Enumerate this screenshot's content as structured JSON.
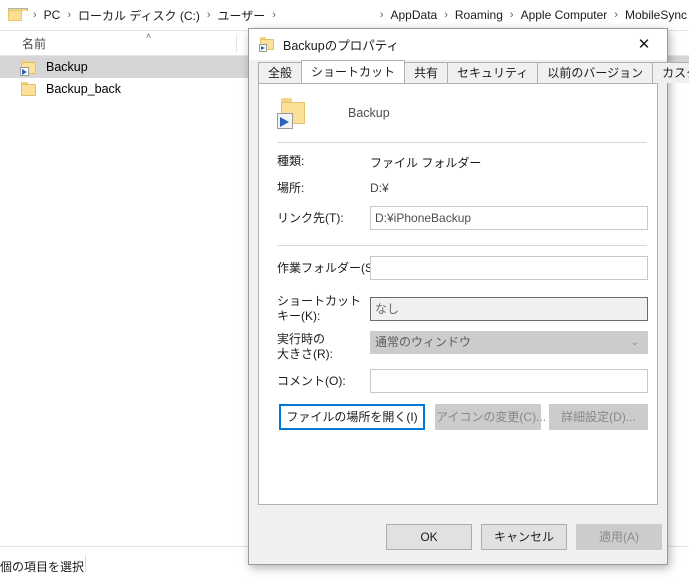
{
  "explorer": {
    "breadcrumb": {
      "folder_icon": "folder-icon",
      "items": [
        "PC",
        "ローカル ディスク (C:)",
        "ユーザー",
        "",
        "AppData",
        "Roaming",
        "Apple Computer",
        "MobileSync"
      ],
      "separator": "›"
    },
    "columns": {
      "name_header": "名前",
      "sort_indicator": "˄"
    },
    "files": [
      {
        "name": "Backup",
        "icon": "folder-shortcut-icon",
        "selected": true
      },
      {
        "name": "Backup_back",
        "icon": "folder-icon",
        "selected": false
      }
    ],
    "statusbar": {
      "text": "個の項目を選択"
    }
  },
  "dialog": {
    "title": "Backupのプロパティ",
    "title_icon": "folder-shortcut-icon",
    "close_label": "✕",
    "tabs": [
      {
        "label": "全般",
        "active": false
      },
      {
        "label": "ショートカット",
        "active": true
      },
      {
        "label": "共有",
        "active": false
      },
      {
        "label": "セキュリティ",
        "active": false
      },
      {
        "label": "以前のバージョン",
        "active": false
      },
      {
        "label": "カスタマイズ",
        "active": false
      }
    ],
    "header": {
      "icon": "folder-shortcut-icon",
      "name": "Backup"
    },
    "fields": {
      "type_label": "種類:",
      "type_value": "ファイル フォルダー",
      "location_label": "場所:",
      "location_value": "D:¥",
      "target_label": "リンク先(T):",
      "target_value": "D:¥iPhoneBackup",
      "workdir_label": "作業フォルダー(S):",
      "workdir_value": "",
      "hotkey_label": "ショートカット\nキー(K):",
      "hotkey_value": "なし",
      "runsize_label": "実行時の\n大きさ(R):",
      "runsize_value": "通常のウィンドウ",
      "runsize_chevron": "⌄",
      "comment_label": "コメント(O):",
      "comment_value": ""
    },
    "action_buttons": [
      {
        "label": "ファイルの場所を開く(I)",
        "state": "focused"
      },
      {
        "label": "アイコンの変更(C)...",
        "state": "disabled"
      },
      {
        "label": "詳細設定(D)...",
        "state": "disabled"
      }
    ],
    "footer_buttons": [
      {
        "label": "OK",
        "state": "normal"
      },
      {
        "label": "キャンセル",
        "state": "normal"
      },
      {
        "label": "適用(A)",
        "state": "disabled"
      }
    ]
  }
}
